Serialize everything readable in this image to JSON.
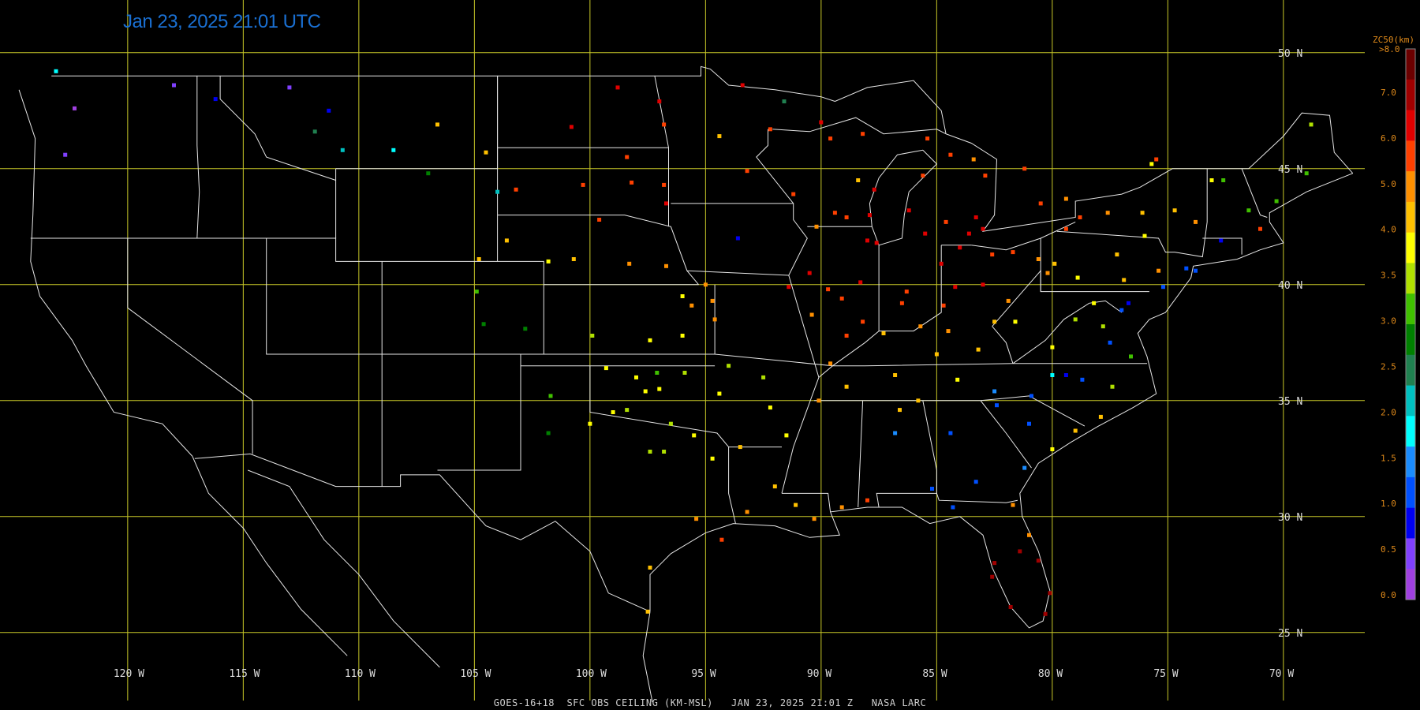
{
  "title": "Jan 23, 2025 21:01 UTC",
  "footer": "GOES-16+18  SFC OBS CEILING (KM-MSL)   JAN 23, 2025 21:01 Z   NASA LARC",
  "colors": {
    "grid": "#c8c828",
    "border": "#e6e6e6",
    "title": "#1a6fd1",
    "legend_label": "#e08a1a"
  },
  "lat_labels": [
    {
      "lat": 50,
      "text": "50 N"
    },
    {
      "lat": 45,
      "text": "45 N"
    },
    {
      "lat": 40,
      "text": "40 N"
    },
    {
      "lat": 35,
      "text": "35 N"
    },
    {
      "lat": 30,
      "text": "30 N"
    },
    {
      "lat": 25,
      "text": "25 N"
    }
  ],
  "lon_labels": [
    {
      "lon": -120,
      "text": "120 W"
    },
    {
      "lon": -115,
      "text": "115 W"
    },
    {
      "lon": -110,
      "text": "110 W"
    },
    {
      "lon": -105,
      "text": "105 W"
    },
    {
      "lon": -100,
      "text": "100 W"
    },
    {
      "lon": -95,
      "text": "95 W"
    },
    {
      "lon": -90,
      "text": "90 W"
    },
    {
      "lon": -85,
      "text": "85 W"
    },
    {
      "lon": -80,
      "text": "80 W"
    },
    {
      "lon": -75,
      "text": "75 W"
    },
    {
      "lon": -70,
      "text": "70 W"
    }
  ],
  "legend": {
    "title": "ZC50(km)",
    "top_label": ">8.0",
    "labels": [
      "7.0",
      "6.0",
      "5.0",
      "4.0",
      "3.5",
      "3.0",
      "2.5",
      "2.0",
      "1.5",
      "1.0",
      "0.5",
      "0.0"
    ],
    "colors_top_to_bottom": [
      "#6b0000",
      "#a00000",
      "#e00000",
      "#ff4000",
      "#ff9000",
      "#ffc000",
      "#ffff00",
      "#b0e000",
      "#40c000",
      "#008000",
      "#208050",
      "#00c0c0",
      "#00ffff",
      "#1a8cff",
      "#0050ff",
      "#0000f0",
      "#8040ff",
      "#a040e0"
    ]
  },
  "stations": [
    [
      -123.1,
      49.2,
      5
    ],
    [
      -122.3,
      47.6,
      0
    ],
    [
      -122.7,
      45.6,
      1
    ],
    [
      -118.0,
      48.6,
      1
    ],
    [
      -116.2,
      48.0,
      2
    ],
    [
      -113.0,
      48.5,
      1
    ],
    [
      -111.3,
      47.5,
      2
    ],
    [
      -110.7,
      45.8,
      6
    ],
    [
      -106.6,
      46.9,
      12
    ],
    [
      -104.5,
      45.7,
      12
    ],
    [
      -100.8,
      46.8,
      15
    ],
    [
      -98.8,
      48.5,
      15
    ],
    [
      -97.0,
      47.9,
      15
    ],
    [
      -96.8,
      46.9,
      14
    ],
    [
      -96.7,
      43.5,
      15
    ],
    [
      -103.2,
      44.1,
      14
    ],
    [
      -100.3,
      44.3,
      14
    ],
    [
      -98.2,
      44.4,
      14
    ],
    [
      -96.7,
      40.8,
      13
    ],
    [
      -98.3,
      40.9,
      13
    ],
    [
      -100.7,
      41.1,
      12
    ],
    [
      -101.8,
      41.0,
      11
    ],
    [
      -103.6,
      41.9,
      12
    ],
    [
      -104.8,
      41.1,
      12
    ],
    [
      -104.9,
      39.7,
      9
    ],
    [
      -104.6,
      38.3,
      8
    ],
    [
      -102.8,
      38.1,
      8
    ],
    [
      -99.9,
      37.8,
      10
    ],
    [
      -97.4,
      37.6,
      11
    ],
    [
      -95.6,
      39.1,
      13
    ],
    [
      -94.7,
      39.3,
      13
    ],
    [
      -97.6,
      35.4,
      11
    ],
    [
      -98.4,
      34.6,
      10
    ],
    [
      -95.9,
      36.2,
      10
    ],
    [
      -99.3,
      36.4,
      11
    ],
    [
      -101.7,
      35.2,
      9
    ],
    [
      -101.8,
      33.6,
      8
    ],
    [
      -97.4,
      32.8,
      10
    ],
    [
      -96.8,
      32.8,
      10
    ],
    [
      -94.7,
      32.5,
      11
    ],
    [
      -94.4,
      35.3,
      11
    ],
    [
      -92.2,
      34.7,
      11
    ],
    [
      -90.1,
      35.0,
      13
    ],
    [
      -89.6,
      36.6,
      13
    ],
    [
      -90.4,
      38.7,
      13
    ],
    [
      -89.7,
      39.8,
      14
    ],
    [
      -88.0,
      41.9,
      15
    ],
    [
      -87.6,
      41.8,
      15
    ],
    [
      -87.9,
      43.0,
      15
    ],
    [
      -89.4,
      43.1,
      14
    ],
    [
      -91.2,
      43.9,
      14
    ],
    [
      -93.2,
      44.9,
      14
    ],
    [
      -94.4,
      46.4,
      12
    ],
    [
      -92.2,
      46.7,
      14
    ],
    [
      -89.6,
      46.3,
      14
    ],
    [
      -88.4,
      44.5,
      12
    ],
    [
      -86.2,
      43.2,
      15
    ],
    [
      -85.5,
      42.2,
      15
    ],
    [
      -84.6,
      42.7,
      14
    ],
    [
      -83.6,
      42.2,
      15
    ],
    [
      -83.0,
      42.4,
      15
    ],
    [
      -84.4,
      45.6,
      14
    ],
    [
      -85.6,
      44.7,
      14
    ],
    [
      -83.3,
      42.9,
      15
    ],
    [
      -84.8,
      40.9,
      15
    ],
    [
      -86.3,
      39.7,
      14
    ],
    [
      -85.7,
      38.2,
      13
    ],
    [
      -84.5,
      38.0,
      13
    ],
    [
      -84.7,
      39.1,
      14
    ],
    [
      -83.0,
      40.0,
      15
    ],
    [
      -81.7,
      41.4,
      14
    ],
    [
      -80.2,
      40.5,
      13
    ],
    [
      -79.9,
      40.9,
      12
    ],
    [
      -78.8,
      42.9,
      14
    ],
    [
      -77.6,
      43.1,
      13
    ],
    [
      -76.1,
      43.1,
      12
    ],
    [
      -73.8,
      42.7,
      13
    ],
    [
      -75.4,
      40.6,
      13
    ],
    [
      -76.9,
      40.2,
      12
    ],
    [
      -79.0,
      38.5,
      10
    ],
    [
      -80.0,
      37.3,
      11
    ],
    [
      -81.6,
      38.4,
      11
    ],
    [
      -82.5,
      38.4,
      12
    ],
    [
      -84.1,
      35.9,
      11
    ],
    [
      -86.8,
      36.1,
      12
    ],
    [
      -88.9,
      35.6,
      12
    ],
    [
      -86.6,
      34.6,
      12
    ],
    [
      -84.4,
      33.6,
      3
    ],
    [
      -86.8,
      33.6,
      4
    ],
    [
      -83.3,
      31.5,
      3
    ],
    [
      -81.2,
      32.1,
      4
    ],
    [
      -80.0,
      32.9,
      11
    ],
    [
      -79.0,
      33.7,
      12
    ],
    [
      -77.9,
      34.3,
      12
    ],
    [
      -77.4,
      35.6,
      10
    ],
    [
      -76.6,
      36.9,
      9
    ],
    [
      -77.5,
      37.5,
      3
    ],
    [
      -77.0,
      38.9,
      3
    ],
    [
      -76.7,
      39.2,
      2
    ],
    [
      -75.2,
      39.9,
      3
    ],
    [
      -74.2,
      40.7,
      3
    ],
    [
      -73.8,
      40.6,
      3
    ],
    [
      -72.7,
      41.9,
      2
    ],
    [
      -71.0,
      42.4,
      14
    ],
    [
      -70.3,
      43.6,
      9
    ],
    [
      -69.0,
      44.8,
      9
    ],
    [
      -68.8,
      46.9,
      10
    ],
    [
      -72.6,
      44.5,
      9
    ],
    [
      -71.5,
      43.2,
      9
    ],
    [
      -81.7,
      30.5,
      13
    ],
    [
      -81.4,
      28.5,
      16
    ],
    [
      -82.5,
      28.0,
      16
    ],
    [
      -80.1,
      26.7,
      16
    ],
    [
      -80.3,
      25.8,
      16
    ],
    [
      -81.8,
      26.1,
      16
    ],
    [
      -82.6,
      27.4,
      16
    ],
    [
      -81.0,
      29.2,
      13
    ],
    [
      -80.6,
      28.1,
      16
    ],
    [
      -97.5,
      25.9,
      12
    ],
    [
      -97.4,
      27.8,
      12
    ],
    [
      -95.4,
      29.9,
      13
    ],
    [
      -94.3,
      29.0,
      14
    ],
    [
      -90.3,
      29.9,
      13
    ],
    [
      -88.0,
      30.7,
      14
    ],
    [
      -89.1,
      30.4,
      13
    ],
    [
      -91.1,
      30.5,
      12
    ],
    [
      -93.2,
      30.2,
      13
    ],
    [
      -92.0,
      31.3,
      12
    ],
    [
      -82.4,
      34.8,
      3
    ],
    [
      -81.0,
      34.0,
      3
    ],
    [
      -80.9,
      35.2,
      3
    ],
    [
      -78.7,
      35.9,
      3
    ],
    [
      -79.4,
      36.1,
      2
    ],
    [
      -82.5,
      35.4,
      4
    ],
    [
      -84.3,
      30.4,
      3
    ],
    [
      -85.2,
      31.2,
      3
    ],
    [
      -80.0,
      36.1,
      5
    ],
    [
      -111.9,
      46.6,
      7
    ],
    [
      -108.5,
      45.8,
      5
    ],
    [
      -107.0,
      44.8,
      8
    ],
    [
      -104.0,
      44.0,
      6
    ],
    [
      -93.6,
      42.0,
      2
    ],
    [
      -90.2,
      42.5,
      13
    ],
    [
      -87.3,
      37.9,
      12
    ],
    [
      -88.2,
      38.4,
      14
    ],
    [
      -85.8,
      35.0,
      12
    ],
    [
      -86.5,
      39.2,
      14
    ],
    [
      -84.2,
      39.9,
      15
    ],
    [
      -84.0,
      41.6,
      15
    ],
    [
      -82.6,
      41.3,
      14
    ],
    [
      -80.6,
      41.1,
      13
    ],
    [
      -78.9,
      40.3,
      11
    ],
    [
      -77.2,
      41.3,
      12
    ],
    [
      -76.0,
      42.1,
      11
    ],
    [
      -74.7,
      43.2,
      12
    ],
    [
      -73.1,
      44.5,
      11
    ],
    [
      -75.5,
      45.4,
      14
    ],
    [
      -79.4,
      43.7,
      13
    ],
    [
      -80.5,
      43.5,
      14
    ],
    [
      -82.9,
      44.7,
      14
    ],
    [
      -81.2,
      45.0,
      14
    ],
    [
      -83.4,
      45.4,
      13
    ],
    [
      -87.7,
      44.1,
      15
    ],
    [
      -88.9,
      42.9,
      14
    ],
    [
      -88.3,
      40.1,
      15
    ],
    [
      -90.5,
      40.5,
      15
    ],
    [
      -91.4,
      39.9,
      15
    ],
    [
      -89.1,
      39.4,
      14
    ],
    [
      -88.9,
      37.8,
      14
    ],
    [
      -85.0,
      37.0,
      12
    ],
    [
      -83.2,
      37.2,
      12
    ],
    [
      -81.9,
      39.3,
      13
    ],
    [
      -79.4,
      42.4,
      14
    ],
    [
      -78.2,
      39.2,
      11
    ],
    [
      -77.8,
      38.2,
      10
    ],
    [
      -75.7,
      45.2,
      11
    ],
    [
      -85.4,
      46.3,
      14
    ],
    [
      -88.2,
      46.5,
      14
    ],
    [
      -90.0,
      47.0,
      15
    ],
    [
      -91.6,
      47.9,
      7
    ],
    [
      -93.4,
      48.6,
      15
    ],
    [
      -96.8,
      44.3,
      14
    ],
    [
      -98.4,
      45.5,
      14
    ],
    [
      -99.6,
      42.8,
      14
    ],
    [
      -95.0,
      40.0,
      13
    ],
    [
      -94.6,
      38.5,
      13
    ],
    [
      -96.0,
      37.8,
      11
    ],
    [
      -97.0,
      35.5,
      11
    ],
    [
      -98.0,
      36.0,
      11
    ],
    [
      -100.0,
      34.0,
      11
    ],
    [
      -99.0,
      34.5,
      11
    ],
    [
      -96.5,
      34.0,
      10
    ],
    [
      -95.5,
      33.5,
      11
    ],
    [
      -93.5,
      33.0,
      12
    ],
    [
      -91.5,
      33.5,
      11
    ],
    [
      -92.5,
      36.0,
      10
    ],
    [
      -94.0,
      36.5,
      10
    ],
    [
      -97.1,
      36.2,
      9
    ],
    [
      -96.0,
      39.5,
      11
    ]
  ]
}
